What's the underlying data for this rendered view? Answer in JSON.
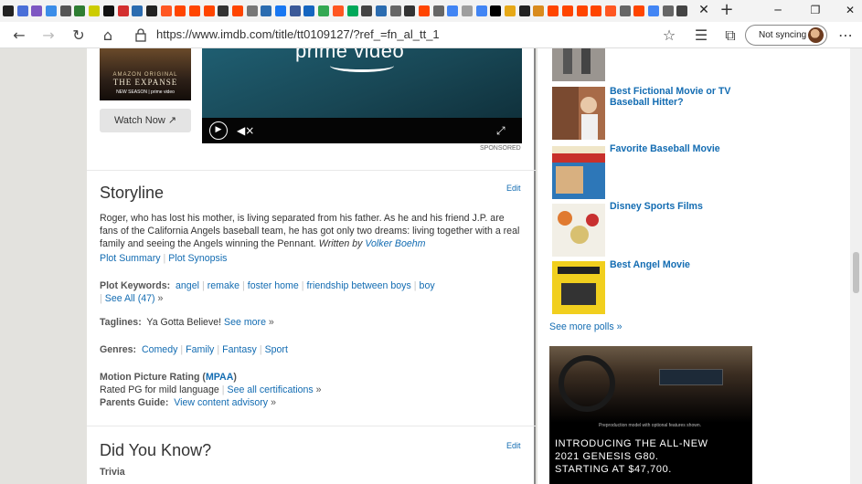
{
  "browser": {
    "tab_icon_colors": [
      "#222222",
      "#4a6fd8",
      "#7e57c2",
      "#3b8de8",
      "#555555",
      "#2e7d32",
      "#cccc00",
      "#111111",
      "#d32f2f",
      "#2b6cb0",
      "#222222",
      "#ff5722",
      "#ff4500",
      "#ff4500",
      "#ff4500",
      "#333333",
      "#ff4500",
      "#777777",
      "#2b6cb0",
      "#1877f2",
      "#3b5998",
      "#1565c0",
      "#34a853",
      "#ff5722",
      "#00a859",
      "#444444",
      "#2b6cb0",
      "#666666",
      "#333333",
      "#ff4500",
      "#666666",
      "#4285f4",
      "#9e9e9e",
      "#4285f4",
      "#000000",
      "#e6a817",
      "#222222",
      "#d98b1d",
      "#ff4500",
      "#ff4500",
      "#ff4500",
      "#ff4500",
      "#ff5722",
      "#666666",
      "#ff4500",
      "#4285f4",
      "#666666",
      "#444444",
      "#555555",
      "#ff8a00",
      "#ff8a00",
      "#333333",
      "#000000"
    ],
    "url": "https://www.imdb.com/title/tt0109127/?ref_=fn_al_tt_1",
    "sync_label": "Not syncing",
    "tab_close": "✕",
    "new_tab": "+"
  },
  "main": {
    "poster": {
      "line1": "AMAZON ORIGINAL",
      "title": "THE EXPANSE",
      "sub": "NEW SEASON | prime video"
    },
    "watch_now": "Watch Now",
    "video_brand": "prime video",
    "sponsored": "SPONSORED",
    "storyline": {
      "heading": "Storyline",
      "edit": "Edit",
      "text": "Roger, who has lost his mother, is living separated from his father. As he and his friend J.P. are fans of the California Angels baseball team, he has got only two dreams: living together with a real family and seeing the Angels winning the Pennant.",
      "written_by": "Written by",
      "author": "Volker Boehm",
      "plot_summary": "Plot Summary",
      "plot_synopsis": "Plot Synopsis",
      "plot_keywords_label": "Plot Keywords:",
      "keywords": [
        "angel",
        "remake",
        "foster home",
        "friendship between boys",
        "boy"
      ],
      "see_all": "See All (47)",
      "taglines_label": "Taglines:",
      "tagline": "Ya Gotta Believe!",
      "see_more": "See more",
      "genres_label": "Genres:",
      "genres": [
        "Comedy",
        "Family",
        "Fantasy",
        "Sport"
      ],
      "rating_label": "Motion Picture Rating (",
      "mpaa": "MPAA",
      "rating_close": ")",
      "rating_text": "Rated PG for mild language",
      "see_all_certs": "See all certifications",
      "parents_label": "Parents Guide:",
      "view_advisory": "View content advisory"
    },
    "did_you_know": {
      "heading": "Did You Know?",
      "edit": "Edit",
      "trivia_label": "Trivia"
    }
  },
  "sidebar": {
    "polls": [
      {
        "title": "",
        "img": "#8a8a8a"
      },
      {
        "title": "Best Fictional Movie or TV Baseball Hitter?",
        "img": "#8a5a3a"
      },
      {
        "title": "Favorite Baseball Movie",
        "img": "#2a6aa8"
      },
      {
        "title": "Disney Sports Films",
        "img": "#d8c070"
      },
      {
        "title": "Best Angel Movie",
        "img": "#e8c820"
      }
    ],
    "see_more_polls": "See more polls",
    "ad": {
      "disclaimer": "Preproduction model with optional features shown.",
      "headline1": "INTRODUCING THE ALL-NEW",
      "headline2": "2021 GENESIS G80.",
      "headline3": "STARTING AT $47,700."
    }
  }
}
